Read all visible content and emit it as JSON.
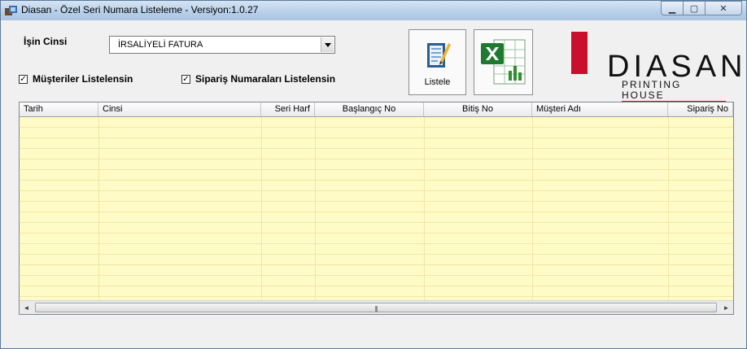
{
  "window": {
    "title": "Diasan - Özel Seri Numara Listeleme - Versiyon:1.0.27",
    "controls": {
      "minimize": "▁",
      "maximize": "▢",
      "close": "✕"
    }
  },
  "form": {
    "isin_cinsi_label": "İşin Cinsi",
    "isin_cinsi_value": "İRSALİYELİ FATURA",
    "musteriler_label": "Müşteriler Listelensin",
    "musteriler_checked": "✓",
    "siparis_label": "Sipariş Numaraları Listelensin",
    "siparis_checked": "✓"
  },
  "toolbar": {
    "listele_label": "Listele",
    "excel_icon": "excel-icon",
    "listele_icon": "document-list-icon"
  },
  "logo": {
    "word": "DIASAN",
    "sub": "PRINTING HOUSE",
    "brand_color": "#c8102e"
  },
  "grid": {
    "columns": [
      "Tarih",
      "Cinsi",
      "Seri Harf",
      "Başlangıç No",
      "Bitiş No",
      "Müşteri Adı",
      "Sipariş No"
    ],
    "row_color": "#fffbc7",
    "scroll_left": "◄",
    "scroll_right": "►",
    "scroll_grip": "|||"
  }
}
